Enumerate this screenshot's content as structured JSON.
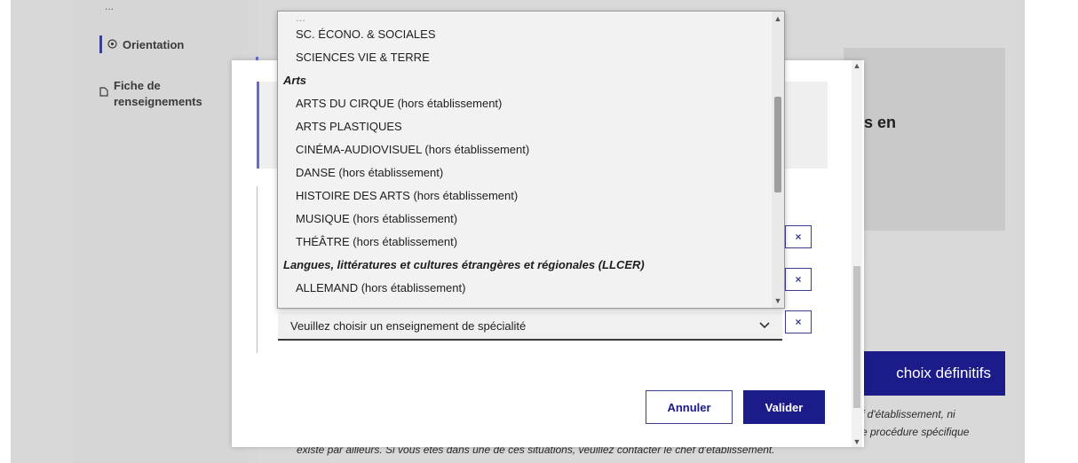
{
  "sidebar": {
    "top_text": "...",
    "orientation": {
      "icon": "circle-dot-icon",
      "label": "Orientation"
    },
    "fiche": {
      "icon": "document-icon",
      "label_line1": "Fiche de",
      "label_line2": "renseignements"
    }
  },
  "background": {
    "panel_text": "is en",
    "confirm_button": "choix définitifs",
    "note_line1": "f d'établissement, ni",
    "note_line2": "e procédure spécifique",
    "note_line3": "existe par ailleurs. Si vous êtes dans une de ces situations, veuillez contacter le chef d'établissement."
  },
  "dropdown": {
    "cutoff_text": "...",
    "items": [
      {
        "type": "option",
        "label": "SC. ÉCONO. & SOCIALES"
      },
      {
        "type": "option",
        "label": "SCIENCES VIE & TERRE"
      },
      {
        "type": "group",
        "label": "Arts"
      },
      {
        "type": "option",
        "label": "ARTS DU CIRQUE (hors établissement)"
      },
      {
        "type": "option",
        "label": "ARTS PLASTIQUES"
      },
      {
        "type": "option",
        "label": "CINÉMA-AUDIOVISUEL (hors établissement)"
      },
      {
        "type": "option",
        "label": "DANSE (hors établissement)"
      },
      {
        "type": "option",
        "label": "HISTOIRE DES ARTS (hors établissement)"
      },
      {
        "type": "option",
        "label": "MUSIQUE (hors établissement)"
      },
      {
        "type": "option",
        "label": "THÉÂTRE (hors établissement)"
      },
      {
        "type": "group",
        "label": "Langues, littératures et cultures étrangères et régionales (LLCER)"
      },
      {
        "type": "option",
        "label": "ALLEMAND (hors établissement)"
      }
    ]
  },
  "modal": {
    "select_placeholder": "Veuillez choisir un enseignement de spécialité",
    "remove_label": "×",
    "cancel_label": "Annuler",
    "validate_label": "Valider"
  },
  "colors": {
    "primary": "#1b1b8a",
    "accent_line": "#6a6ad0",
    "overlay_grey": "#d7d7d7"
  }
}
